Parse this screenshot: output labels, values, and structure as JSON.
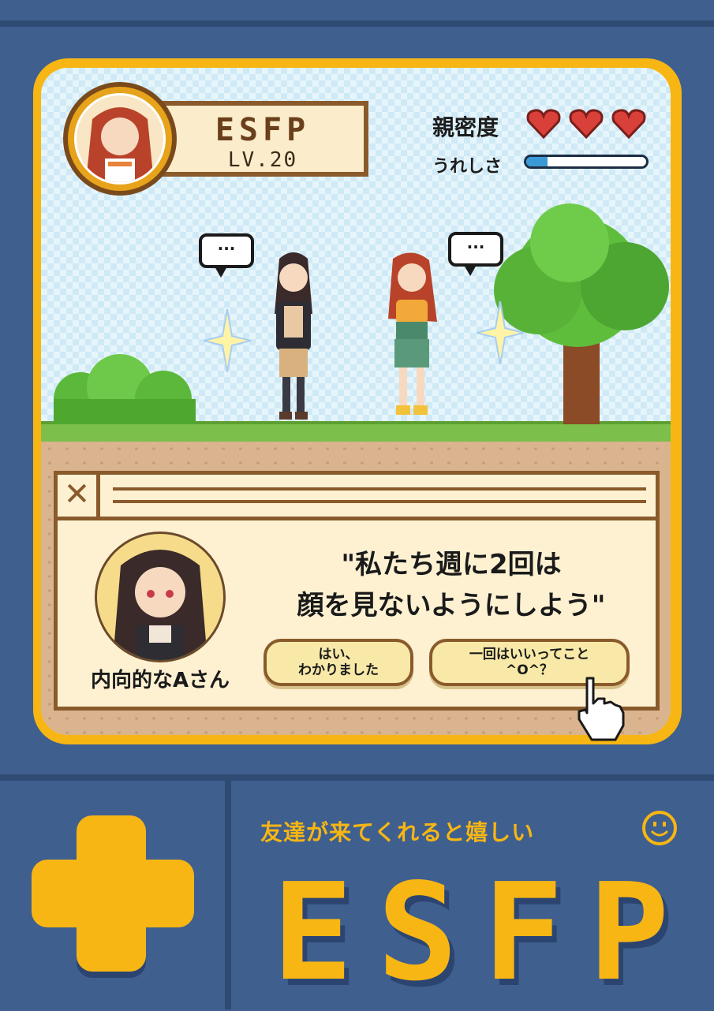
{
  "profile": {
    "type_name": "ESFP",
    "level": "LV.20"
  },
  "stats": {
    "intimacy_label": "親密度",
    "intimacy_hearts": 3,
    "happiness_label": "うれしさ",
    "happiness_level": 0.18
  },
  "scene": {
    "bubble_left": "···",
    "bubble_right": "···"
  },
  "dialog": {
    "speaker_name": "内向的なAさん",
    "quote": "\"私たち週に2回は\n顔を見ないようにしよう\"",
    "choices": [
      {
        "label": "はい、\nわかりました"
      },
      {
        "label": "一回はいいってこと\n^O^？"
      }
    ]
  },
  "footer": {
    "tagline": "友達が来てくれると嬉しい",
    "big_title": [
      "E",
      "S",
      "F",
      "P"
    ]
  },
  "colors": {
    "accent": "#f7b613",
    "background": "#3f5f8f",
    "heart": "#d9403a"
  }
}
